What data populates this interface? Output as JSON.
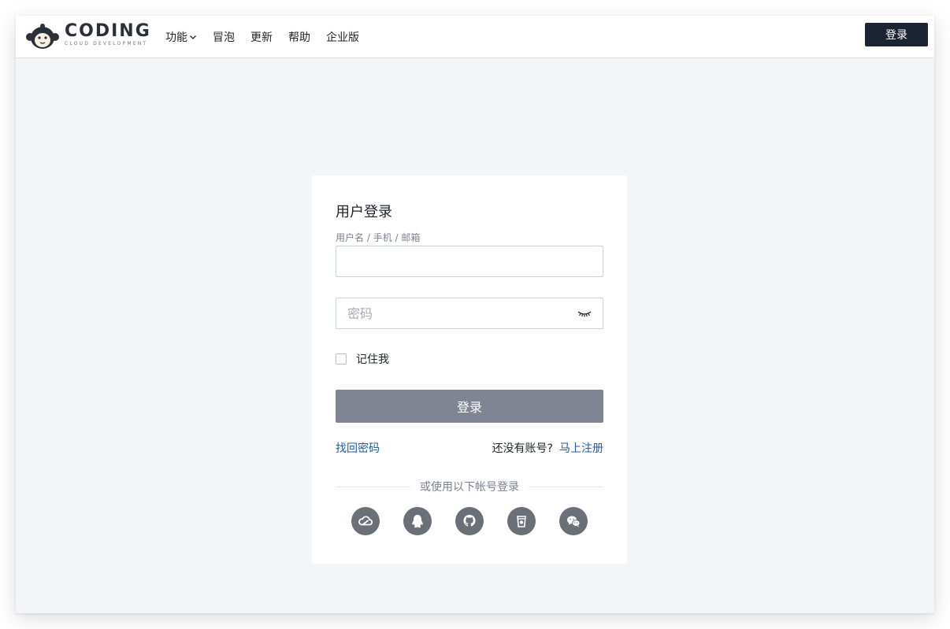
{
  "app": {
    "brand": "CODING",
    "brand_sub": "CLOUD DEVELOPMENT",
    "colors": {
      "dark_button": "#1c2333",
      "link": "#1f5aa6",
      "submit_disabled": "#7f8592",
      "page_bg": "#f3f5f9"
    }
  },
  "nav": {
    "items": [
      {
        "label": "功能",
        "has_dropdown": true
      },
      {
        "label": "冒泡"
      },
      {
        "label": "更新"
      },
      {
        "label": "帮助"
      },
      {
        "label": "企业版"
      }
    ],
    "login_label": "登录"
  },
  "login": {
    "title": "用户登录",
    "username_label": "用户名 / 手机 / 邮箱",
    "username_value": "",
    "password_placeholder": "密码",
    "remember_label": "记住我",
    "remember_checked": false,
    "submit_label": "登录",
    "forgot_label": "找回密码",
    "no_account_label": "还没有账号?",
    "register_label": "马上注册",
    "divider_label": "或使用以下帐号登录",
    "social_icons": [
      "tencent-cloud-icon",
      "qq-icon",
      "github-icon",
      "gitee-icon",
      "wechat-icon"
    ]
  }
}
